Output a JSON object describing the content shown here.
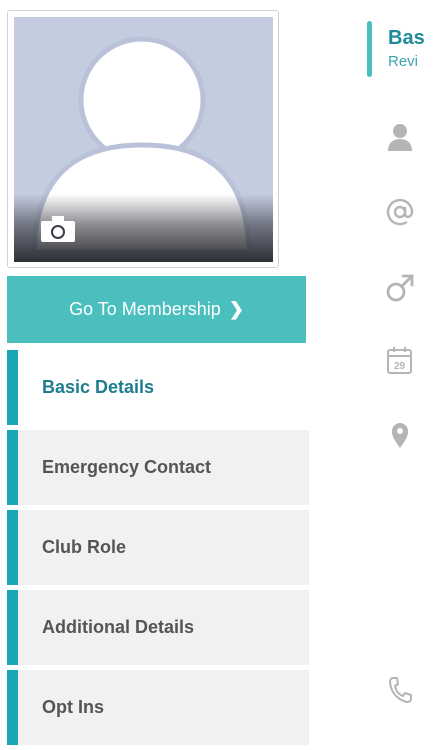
{
  "profile": {
    "photo_icon": "default-avatar-icon",
    "camera_icon": "camera-icon"
  },
  "membership_button": {
    "label": "Go To Membership",
    "chevron": "❯"
  },
  "nav": {
    "items": [
      {
        "label": "Basic Details",
        "active": true
      },
      {
        "label": "Emergency Contact",
        "active": false
      },
      {
        "label": "Club Role",
        "active": false
      },
      {
        "label": "Additional Details",
        "active": false
      },
      {
        "label": "Opt Ins",
        "active": false
      }
    ]
  },
  "section": {
    "title": "Bas",
    "subtitle": "Revi"
  },
  "field_icons": [
    "person-icon",
    "at-icon",
    "male-icon",
    "calendar-icon",
    "location-pin-icon",
    "phone-icon"
  ],
  "calendar_day": "29",
  "colors": {
    "accent_teal": "#4bbfbd",
    "nav_bar_teal": "#1aa6b4",
    "active_text": "#1e7e8f",
    "icon_gray": "#b5b5b5"
  }
}
